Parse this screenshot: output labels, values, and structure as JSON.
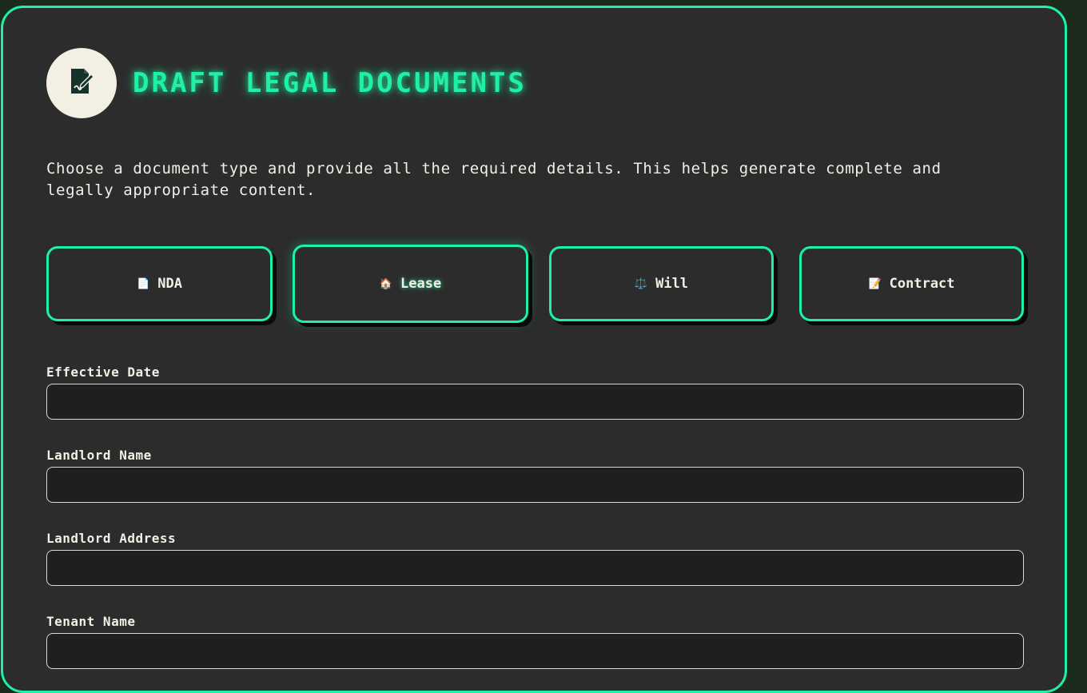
{
  "header": {
    "title": "DRAFT LEGAL DOCUMENTS",
    "logo_icon": "document-signature-icon"
  },
  "description": "Choose a document type and provide all the required details. This helps generate complete and legally appropriate content.",
  "document_types": [
    {
      "label": "NDA",
      "icon": "📄",
      "icon_name": "page-icon",
      "active": false
    },
    {
      "label": "Lease",
      "icon": "🏠",
      "icon_name": "house-icon",
      "active": true
    },
    {
      "label": "Will",
      "icon": "⚖️",
      "icon_name": "scales-icon",
      "active": false
    },
    {
      "label": "Contract",
      "icon": "📝",
      "icon_name": "memo-icon",
      "active": false
    }
  ],
  "fields": [
    {
      "label": "Effective Date",
      "value": ""
    },
    {
      "label": "Landlord Name",
      "value": ""
    },
    {
      "label": "Landlord Address",
      "value": ""
    },
    {
      "label": "Tenant Name",
      "value": ""
    }
  ],
  "colors": {
    "accent": "#1ff0a8",
    "panel_bg": "#2c2c2c",
    "input_bg": "#1f1f21",
    "logo_bg": "#f3efe2"
  }
}
